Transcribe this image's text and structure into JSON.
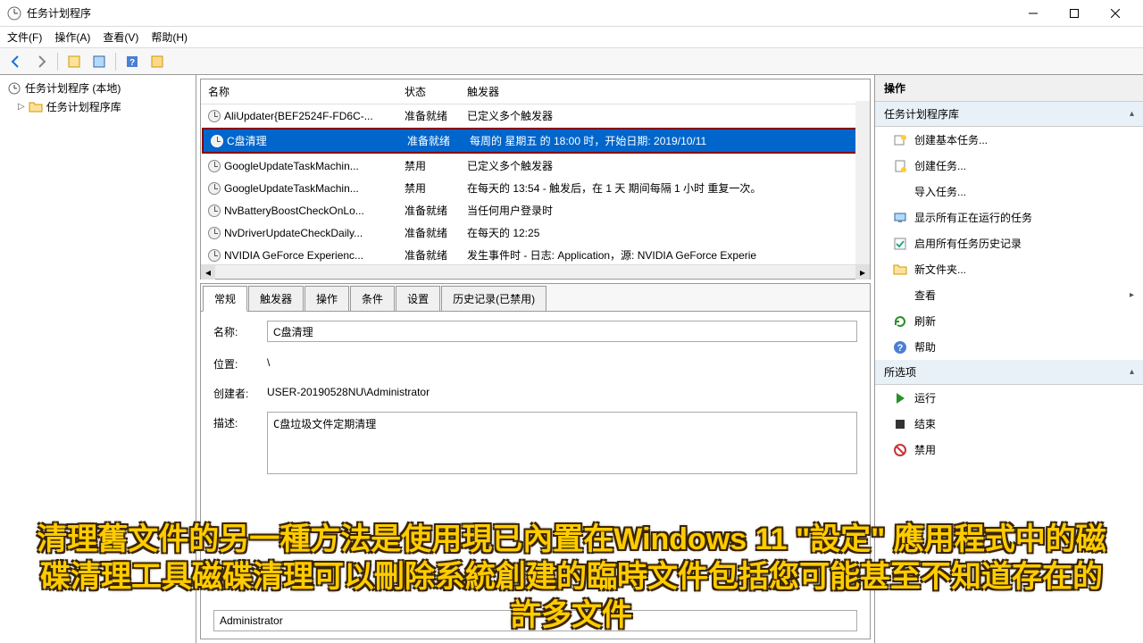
{
  "window": {
    "title": "任务计划程序",
    "menus": [
      "文件(F)",
      "操作(A)",
      "查看(V)",
      "帮助(H)"
    ]
  },
  "tree": {
    "root": "任务计划程序 (本地)",
    "child": "任务计划程序库"
  },
  "task_list": {
    "headers": {
      "name": "名称",
      "status": "状态",
      "trigger": "触发器"
    },
    "rows": [
      {
        "name": "AliUpdater{BEF2524F-FD6C-...",
        "status": "准备就绪",
        "trigger": "已定义多个触发器",
        "selected": false
      },
      {
        "name": "C盘清理",
        "status": "准备就绪",
        "trigger": "每周的 星期五 的 18:00 时，开始日期: 2019/10/11",
        "selected": true
      },
      {
        "name": "GoogleUpdateTaskMachin...",
        "status": "禁用",
        "trigger": "已定义多个触发器",
        "selected": false
      },
      {
        "name": "GoogleUpdateTaskMachin...",
        "status": "禁用",
        "trigger": "在每天的 13:54 - 触发后，在 1 天 期间每隔 1 小时 重复一次。",
        "selected": false
      },
      {
        "name": "NvBatteryBoostCheckOnLo...",
        "status": "准备就绪",
        "trigger": "当任何用户登录时",
        "selected": false
      },
      {
        "name": "NvDriverUpdateCheckDaily...",
        "status": "准备就绪",
        "trigger": "在每天的 12:25",
        "selected": false
      },
      {
        "name": "NVIDIA GeForce Experienc...",
        "status": "准备就绪",
        "trigger": "发生事件时 - 日志: Application，源: NVIDIA GeForce Experie",
        "selected": false
      }
    ]
  },
  "tabs": [
    "常规",
    "触发器",
    "操作",
    "条件",
    "设置",
    "历史记录(已禁用)"
  ],
  "general": {
    "name_label": "名称:",
    "name_value": "C盘清理",
    "location_label": "位置:",
    "location_value": "\\",
    "creator_label": "创建者:",
    "creator_value": "USER-20190528NU\\Administrator",
    "desc_label": "描述:",
    "desc_value": "C盘垃圾文件定期清理",
    "user_value": "Administrator"
  },
  "actions": {
    "header": "操作",
    "section1": "任务计划程序库",
    "items1": [
      {
        "icon": "wizard",
        "label": "创建基本任务..."
      },
      {
        "icon": "task",
        "label": "创建任务..."
      },
      {
        "icon": "blank",
        "label": "导入任务..."
      },
      {
        "icon": "display",
        "label": "显示所有正在运行的任务"
      },
      {
        "icon": "enable",
        "label": "启用所有任务历史记录"
      },
      {
        "icon": "folder",
        "label": "新文件夹..."
      },
      {
        "icon": "blank",
        "label": "查看",
        "arrow": true
      },
      {
        "icon": "refresh",
        "label": "刷新"
      },
      {
        "icon": "help",
        "label": "帮助"
      }
    ],
    "section2": "所选项",
    "items2": [
      {
        "icon": "run",
        "label": "运行"
      },
      {
        "icon": "end",
        "label": "结束"
      },
      {
        "icon": "disable",
        "label": "禁用"
      }
    ]
  },
  "subtitle": "清理舊文件的另一種方法是使用現已內置在Windows 11 \"設定\" 應用程式中的磁碟清理工具磁碟清理可以刪除系統創建的臨時文件包括您可能甚至不知道存在的許多文件"
}
